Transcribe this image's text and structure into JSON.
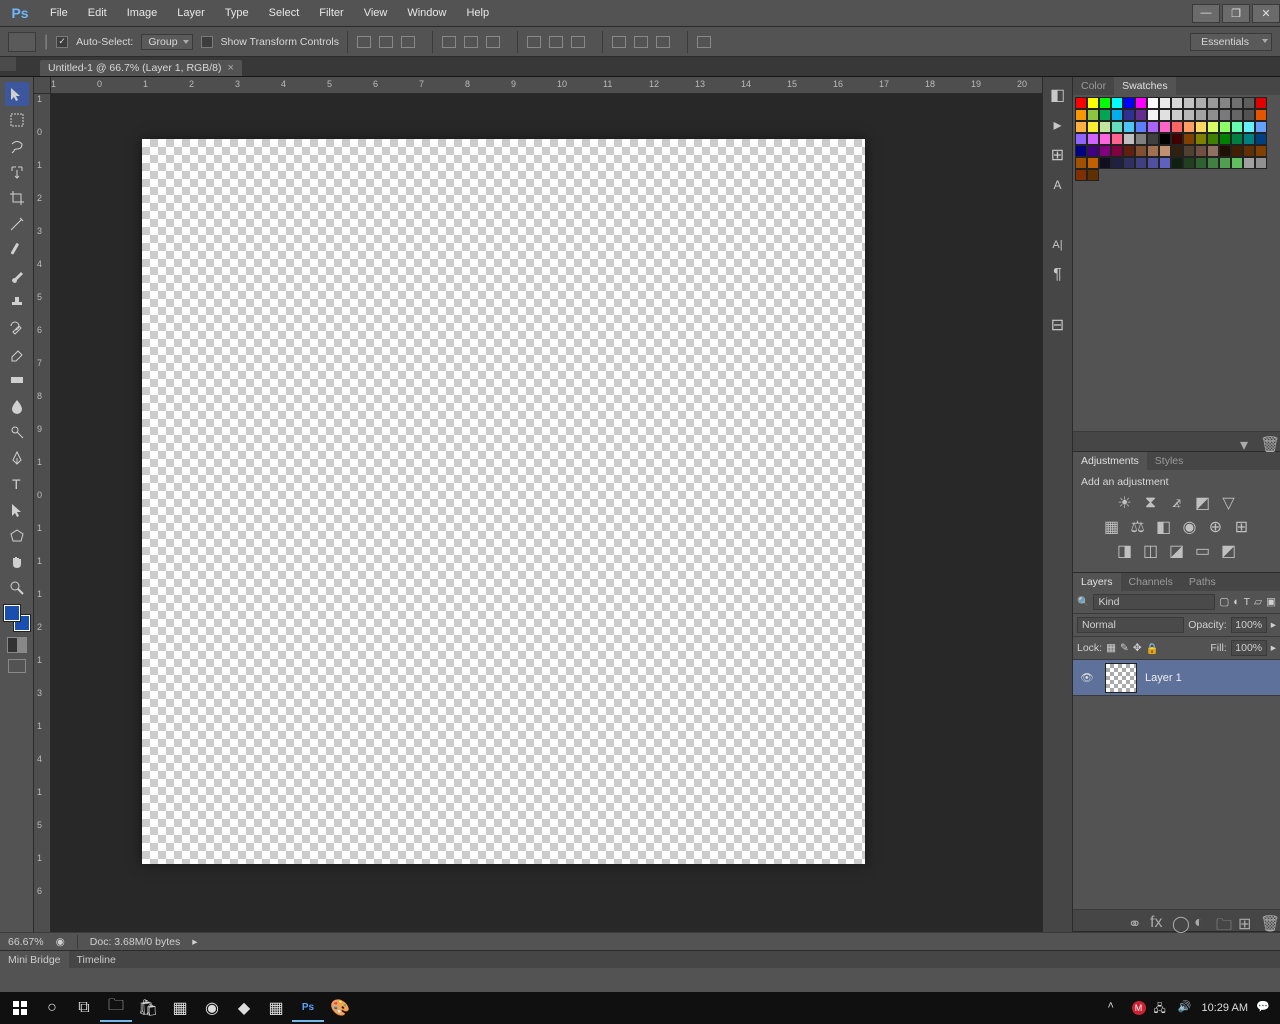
{
  "menu": {
    "items": [
      "File",
      "Edit",
      "Image",
      "Layer",
      "Type",
      "Select",
      "Filter",
      "View",
      "Window",
      "Help"
    ]
  },
  "options": {
    "auto_select_label": "Auto-Select:",
    "auto_select_checked": "✓",
    "group_dd": "Group",
    "transform_label": "Show Transform Controls",
    "workspace": "Essentials"
  },
  "doc_tab": {
    "title": "Untitled-1 @ 66.7% (Layer 1, RGB/8)"
  },
  "ruler_h": [
    "1",
    "0",
    "1",
    "2",
    "3",
    "4",
    "5",
    "6",
    "7",
    "8",
    "9",
    "10",
    "11",
    "12",
    "13",
    "14",
    "15",
    "16",
    "17",
    "18",
    "19",
    "20"
  ],
  "ruler_v": [
    "1",
    "0",
    "1",
    "2",
    "3",
    "4",
    "5",
    "6",
    "7",
    "8",
    "9",
    "1",
    "0",
    "1",
    "1",
    "1",
    "2",
    "1",
    "3",
    "1",
    "4",
    "1",
    "5",
    "1",
    "6"
  ],
  "right": {
    "color_tab": "Color",
    "swatches_tab": "Swatches",
    "adjustments_tab": "Adjustments",
    "styles_tab": "Styles",
    "adj_label": "Add an adjustment",
    "layers_tab": "Layers",
    "channels_tab": "Channels",
    "paths_tab": "Paths",
    "kind": "Kind",
    "blend": "Normal",
    "opacity_label": "Opacity:",
    "opacity": "100%",
    "lock_label": "Lock:",
    "fill_label": "Fill:",
    "fill": "100%",
    "layer1": "Layer 1"
  },
  "status": {
    "zoom": "66.67%",
    "doc": "Doc: 3.68M/0 bytes"
  },
  "btabs": {
    "mini": "Mini Bridge",
    "timeline": "Timeline"
  },
  "tray": {
    "time": "10:29 AM"
  },
  "swatch_colors": [
    "#ff0000",
    "#ffff00",
    "#00ff00",
    "#00ffff",
    "#0000ff",
    "#ff00ff",
    "#ffffff",
    "#ebebeb",
    "#d6d6d6",
    "#c2c2c2",
    "#adadad",
    "#999999",
    "#858585",
    "#707070",
    "#5c5c5c",
    "#e00000",
    "#f79800",
    "#8cc63e",
    "#00a651",
    "#00aeef",
    "#2e3192",
    "#662d91",
    "#f5f5f5",
    "#e0e0e0",
    "#ccc",
    "#b8b8b8",
    "#a3a3a3",
    "#8f8f8f",
    "#7a7a7a",
    "#666",
    "#525252",
    "#e65400",
    "#fbb040",
    "#f9ed32",
    "#c2e59c",
    "#64debf",
    "#4fc5f7",
    "#5a7fff",
    "#a864ff",
    "#ff64c8",
    "#ff6464",
    "#ff9d64",
    "#ffd664",
    "#d6ff64",
    "#8cff64",
    "#64ffb0",
    "#64f0ff",
    "#64a0ff",
    "#9064ff",
    "#d064ff",
    "#ff64e0",
    "#ff6490",
    "#c0c0c0",
    "#808080",
    "#404040",
    "#000000",
    "#400000",
    "#804000",
    "#808000",
    "#408000",
    "#008000",
    "#008040",
    "#008080",
    "#004080",
    "#000080",
    "#400080",
    "#800080",
    "#800040",
    "#602010",
    "#805030",
    "#a07050",
    "#c09070",
    "#302010",
    "#504030",
    "#705040",
    "#907060",
    "#201000",
    "#402000",
    "#603000",
    "#804000",
    "#a05000",
    "#c06000",
    "#101020",
    "#202040",
    "#303060",
    "#404080",
    "#5050a0",
    "#6060c0",
    "#102010",
    "#204020",
    "#306030",
    "#408040",
    "#50a050",
    "#60c060",
    "#a0a0a0",
    "#909090",
    "#803000",
    "#603000"
  ]
}
